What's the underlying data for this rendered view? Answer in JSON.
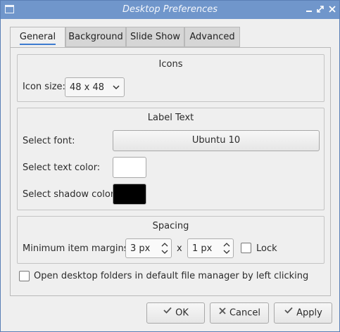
{
  "window": {
    "title": "Desktop Preferences"
  },
  "tabs": [
    {
      "label": "General",
      "active": true
    },
    {
      "label": "Background",
      "active": false
    },
    {
      "label": "Slide Show",
      "active": false
    },
    {
      "label": "Advanced",
      "active": false
    }
  ],
  "icons_group": {
    "title": "Icons",
    "icon_size_label": "Icon size:",
    "icon_size_value": "48 x 48"
  },
  "label_text_group": {
    "title": "Label Text",
    "font_label": "Select font:",
    "font_value": "Ubuntu 10",
    "text_color_label": "Select text color:",
    "text_color": "#ffffff",
    "shadow_color_label": "Select shadow color:",
    "shadow_color": "#000000"
  },
  "spacing_group": {
    "title": "Spacing",
    "margins_label": "Minimum item margins:",
    "margin_x_value": "3 px",
    "separator": "x",
    "margin_y_value": "1 px",
    "lock_label": "Lock",
    "lock_checked": false
  },
  "open_folders_label": "Open desktop folders in default file manager by left clicking",
  "open_folders_checked": false,
  "buttons": {
    "ok": "OK",
    "cancel": "Cancel",
    "apply": "Apply"
  },
  "colors": {
    "titlebar": "#7096cb",
    "accent": "#3c7bd0"
  }
}
